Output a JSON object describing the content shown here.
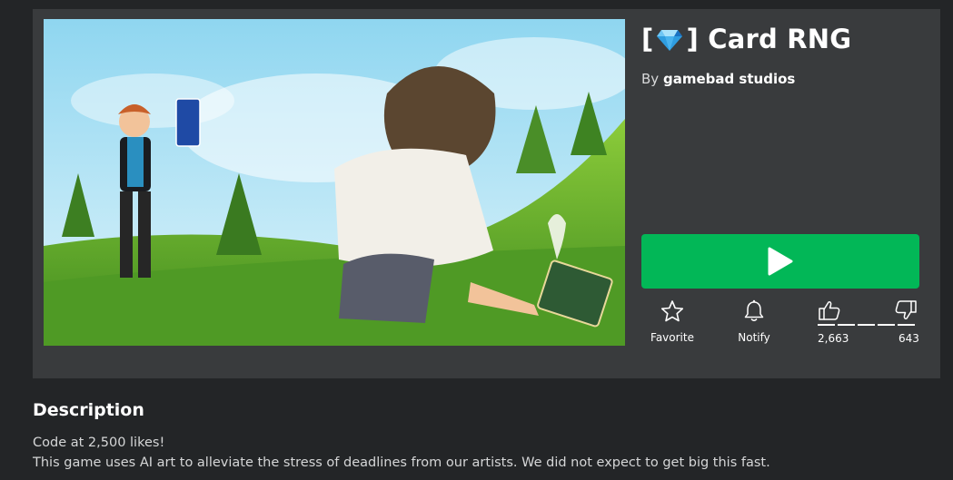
{
  "game": {
    "title_prefix": "[",
    "title_suffix": "] Card RNG",
    "title_icon": "diamond-gem-icon",
    "creator_prefix": "By",
    "creator_name": "gamebad studios",
    "thumbnail": "game-thumbnail-artwork"
  },
  "actions": {
    "play_icon": "play-icon",
    "favorite_label": "Favorite",
    "notify_label": "Notify"
  },
  "votes": {
    "up_count": "2,663",
    "down_count": "643",
    "up_ratio": 0.805
  },
  "description": {
    "heading": "Description",
    "line1": "Code at 2,500 likes!",
    "line2": "This game uses AI art to alleviate the stress of deadlines from our artists. We did not expect to get big this fast."
  },
  "colors": {
    "play_green": "#02b757",
    "panel": "#393b3d",
    "background": "#232527"
  }
}
